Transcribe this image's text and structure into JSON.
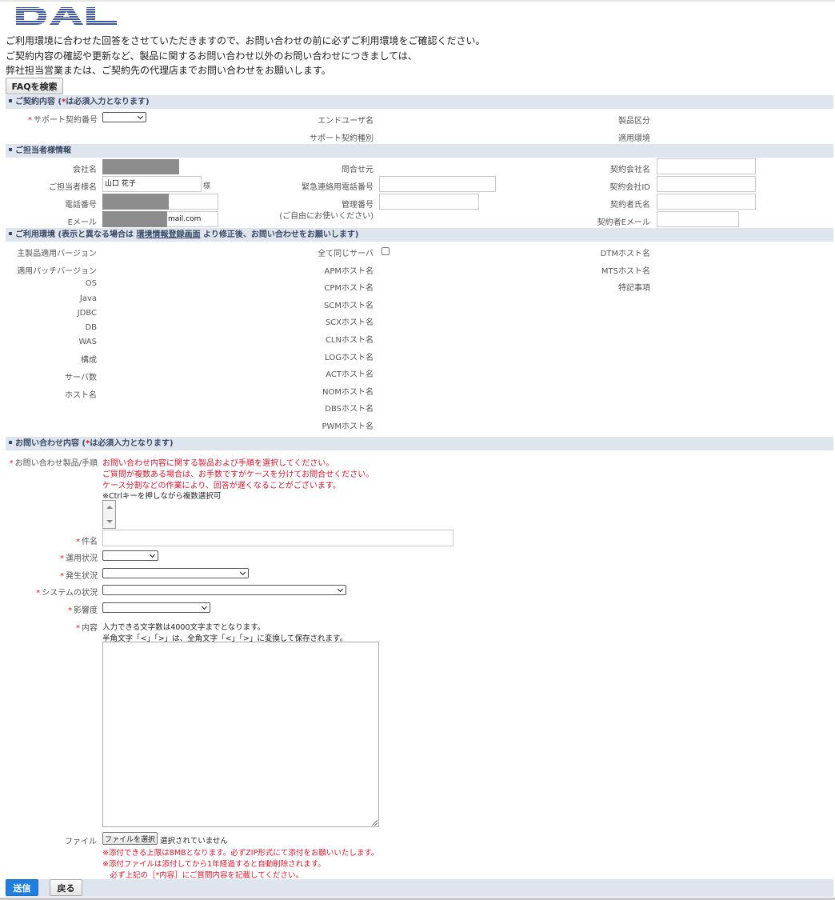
{
  "logo_text": "DAL",
  "intro": [
    "ご利用環境に合わせた回答をさせていただきますので、お問い合わせの前に必ずご利用環境をご確認ください。",
    "ご契約内容の確認や更新など、製品に関するお問い合わせ以外のお問い合わせにつきましては、",
    "弊社担当営業または、ご契約先の代理店までお問い合わせをお願いします。"
  ],
  "faq_button": "FAQを検索",
  "section1": {
    "title": "ご契約内容 (",
    "star": "*",
    "title_tail": "は必須入力となります)",
    "support_contract_no": "サポート契約番号",
    "end_user_name": "エンドユーザ名",
    "product_category": "製品区分",
    "support_contract_type": "サポート契約種別",
    "applied_env": "適用環境"
  },
  "section2": {
    "title": "ご担当者様情報",
    "company_name": "会社名",
    "contact_name": "ご担当者様名",
    "contact_name_value": "山口 花子",
    "honorific": "様",
    "phone": "電話番号",
    "email": "Eメール",
    "email_value_suffix": "mail.com",
    "inquiry_source": "問合せ元",
    "emergency_phone": "緊急連絡用電話番号",
    "mgmt_no": "管理番号",
    "mgmt_no_note": "(ご自由にお使いください)",
    "contract_company": "契約会社名",
    "contract_company_id": "契約会社ID",
    "contractor_name": "契約者氏名",
    "contractor_email": "契約者Eメール"
  },
  "section3": {
    "title_pre": "ご利用環境 (表示と異なる場合は ",
    "title_link": "環境情報登録画面",
    "title_post": " より修正後、お問い合わせをお願いします)",
    "left_labels": [
      "主製品適用バージョン",
      "適用パッチバージョン",
      "OS",
      "Java",
      "JDBC",
      "DB",
      "WAS",
      "構成",
      "サーバ数",
      "ホスト名"
    ],
    "all_same_server": "全て同じサーバ",
    "mid_labels": [
      "APMホスト名",
      "CPMホスト名",
      "SCMホスト名",
      "SCXホスト名",
      "CLNホスト名",
      "LOGホスト名",
      "ACTホスト名",
      "NOMホスト名",
      "DBSホスト名",
      "PWMホスト名"
    ],
    "right_labels": [
      "DTMホスト名",
      "MTSホスト名",
      "特記事項"
    ]
  },
  "section4": {
    "title": "お問い合わせ内容 (",
    "star": "*",
    "title_tail": "は必須入力となります)",
    "product_proc_label": "お問い合わせ製品/手順",
    "product_proc_red": [
      "お問い合わせ内容に関する製品および手順を選択してください。",
      "ご質問が複数ある場合は、お手数ですがケースを分けてお問合せください。",
      "ケース分割などの作業により、回答が遅くなることがございます。"
    ],
    "ctrl_note": "※Ctrlキーを押しながら複数選択可",
    "subject": "件名",
    "usage_status": "運用状況",
    "occurrence_status": "発生状況",
    "system_status": "システムの状況",
    "impact": "影響度",
    "content": "内容",
    "content_notes": [
      "入力できる文字数は4000文字までとなります。",
      "半角文字「<」「>」は、全角文字「<」「>」に変換して保存されます。"
    ],
    "file": "ファイル",
    "file_button": "ファイルを選択",
    "file_status": "選択されていません",
    "file_red": [
      "※添付できる上限は8MBとなります。必ずZIP形式にて添付をお願いいたします。",
      "※添付ファイルは添付してから1年経過すると自動削除されます。",
      "　必ず上記の［*内容］にご質問内容を記載してください。"
    ]
  },
  "footer": {
    "send": "送信",
    "back": "戻る"
  },
  "colors": {
    "section_bg": "#dfe5ee",
    "required": "#e0142c",
    "send_button": "#1f7fe0",
    "logo": "#3d58a6"
  }
}
